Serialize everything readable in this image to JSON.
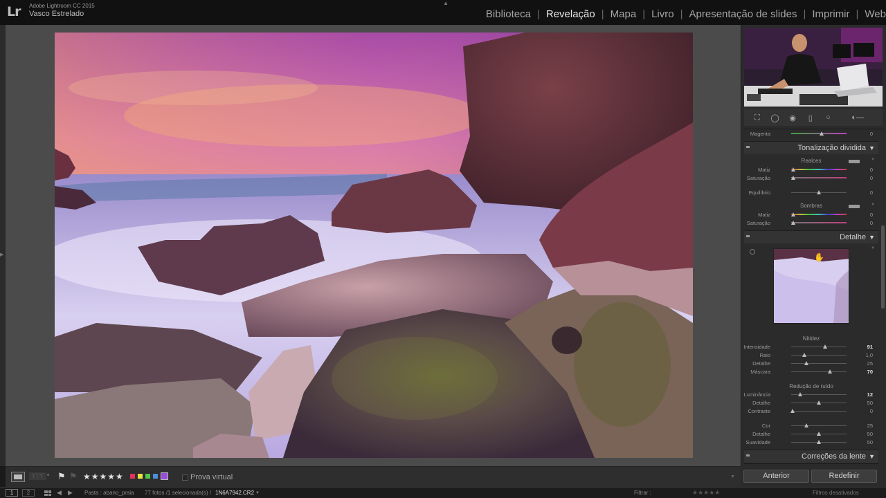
{
  "app": {
    "product": "Adobe Lightroom CC 2015",
    "user": "Vasco Estrelado",
    "logo": "Lr"
  },
  "modules": [
    {
      "label": "Biblioteca",
      "active": false
    },
    {
      "label": "Revelação",
      "active": true
    },
    {
      "label": "Mapa",
      "active": false
    },
    {
      "label": "Livro",
      "active": false
    },
    {
      "label": "Apresentação de slides",
      "active": false
    },
    {
      "label": "Imprimir",
      "active": false
    },
    {
      "label": "Web",
      "active": false
    }
  ],
  "module_separator": "|",
  "toolbar": {
    "compare_label": "Y|Y",
    "stars": "★★★★★",
    "color_labels": [
      "#e0335a",
      "#e6e640",
      "#4ec74e",
      "#4a8fd8",
      "#9a4ed8"
    ],
    "soft_proof_label": "Prova virtual"
  },
  "right_panel": {
    "hsl_tail": {
      "label": "Magenta",
      "value": "0",
      "pos": 0.55
    },
    "split_toning": {
      "title": "Tonalização dividida",
      "highlights_label": "Realces",
      "highlights_hue": {
        "label": "Matiz",
        "value": "0",
        "pos": 0.04
      },
      "highlights_sat": {
        "label": "Saturação",
        "value": "0",
        "pos": 0.04
      },
      "balance": {
        "label": "Equilíbrio",
        "value": "0",
        "pos": 0.5
      },
      "shadows_label": "Sombras",
      "shadows_hue": {
        "label": "Matiz",
        "value": "0",
        "pos": 0.04
      },
      "shadows_sat": {
        "label": "Saturação",
        "value": "0",
        "pos": 0.04
      }
    },
    "detail": {
      "title": "Detalhe",
      "sharpening_label": "Nitidez",
      "amount": {
        "label": "Intensidade",
        "value": "91",
        "pos": 0.61
      },
      "radius": {
        "label": "Raio",
        "value": "1,0",
        "pos": 0.24
      },
      "detail": {
        "label": "Detalhe",
        "value": "25",
        "pos": 0.27
      },
      "masking": {
        "label": "Máscara",
        "value": "70",
        "pos": 0.7
      },
      "noise_label": "Redução de ruído",
      "luminance": {
        "label": "Luminância",
        "value": "12",
        "pos": 0.16
      },
      "lum_detail": {
        "label": "Detalhe",
        "value": "50",
        "pos": 0.5
      },
      "lum_contrast": {
        "label": "Contraste",
        "value": "0",
        "pos": 0.03
      },
      "color": {
        "label": "Cor",
        "value": "25",
        "pos": 0.27
      },
      "color_detail": {
        "label": "Detalhe",
        "value": "50",
        "pos": 0.5
      },
      "color_smooth": {
        "label": "Suavidade",
        "value": "50",
        "pos": 0.5
      }
    },
    "lens": {
      "title": "Correções da lente"
    },
    "buttons": {
      "previous": "Anterior",
      "reset": "Redefinir"
    }
  },
  "filmstrip_bar": {
    "monitor1": "1",
    "monitor2": "2",
    "folder": "Pasta : abano_praia",
    "count": "77 fotos /1 selecionada(s) /",
    "filename": "1N6A7942.CR2",
    "filter_label": "Filtrar :",
    "filter_status": "Filtros desativados"
  },
  "icons": {
    "flag": "flag-icon",
    "flag_reject": "reject-flag-icon",
    "grid": "grid-view-icon",
    "prev": "back-arrow-icon",
    "next": "forward-arrow-icon"
  }
}
